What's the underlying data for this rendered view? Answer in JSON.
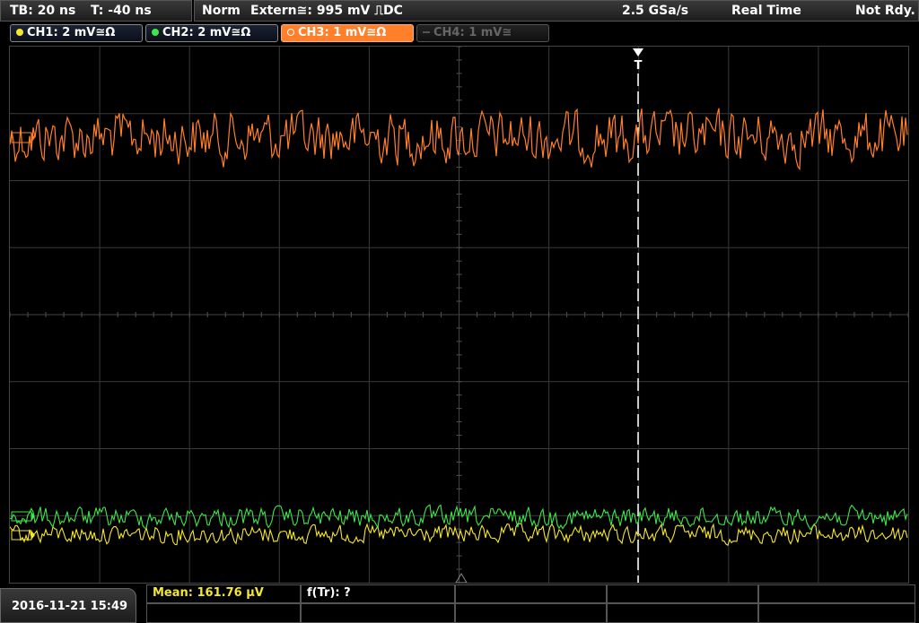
{
  "status_bar": {
    "timebase": "TB: 20 ns",
    "trigger_time": "T: -40 ns",
    "trigger_mode": "Norm",
    "trigger_source": "Extern≅: 995 mV ⎍DC",
    "sample_rate": "2.5 GSa/s",
    "acquisition_mode": "Real Time",
    "status": "Not Rdy."
  },
  "channels": [
    {
      "label": "CH1: 2 mV≅Ω",
      "color": "#f5e62e",
      "active": false,
      "enabled": true
    },
    {
      "label": "CH2: 2 mV≅Ω",
      "color": "#3ee64a",
      "active": false,
      "enabled": true
    },
    {
      "label": "CH3: 1 mV≅Ω",
      "color": "#ff7f2a",
      "active": true,
      "enabled": true
    },
    {
      "label": "CH4: 1 mV≅",
      "color": "#555555",
      "active": false,
      "enabled": false
    }
  ],
  "trigger_marker": "T",
  "measurements": {
    "mean": "Mean: 161.76 µV",
    "freq": "f(Tr): ?"
  },
  "datetime": "2016-11-21 15:49",
  "colors": {
    "grid": "#3a3a3a",
    "ch1": "#f5e62e",
    "ch2": "#3ee64a",
    "ch3": "#ff7f2a",
    "measure_text": "#f5e62e"
  }
}
